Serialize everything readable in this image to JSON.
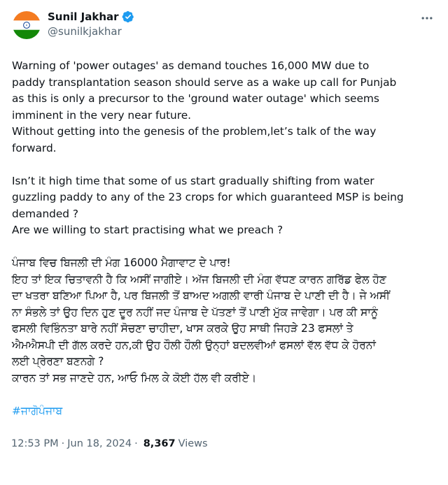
{
  "author": {
    "display_name": "Sunil Jakhar",
    "handle": "@sunilkjakhar",
    "verified": true,
    "avatar_icon": "indian-flag-avatar",
    "verified_color": "#1d9bf0"
  },
  "tweet": {
    "english": [
      "Warning of 'power outages' as demand touches 16,000 MW due to",
      "paddy transplantation season should serve as a wake up call for Punjab",
      "as this is only a precursor to the 'ground water outage' which seems",
      "imminent in the very near future.",
      "Without getting into the genesis of the problem,let’s talk of the way",
      "forward."
    ],
    "english2": [
      "Isn’t it high time that some of us start gradually shifting from water",
      "guzzling paddy to any of the 23 crops for which guaranteed MSP is being",
      "demanded ?",
      "Are we willing to start practising what we preach ?"
    ],
    "punjabi": [
      "ਪੰਜਾਬ ਵਿਚ ਬਿਜਲੀ ਦੀ ਮੰਗ 16000 ਮੈਗਾਵਾਟ ਦੇ ਪਾਰ!",
      "ਇਹ ਤਾਂ ਇਕ ਚਿਤਾਵਨੀ ਹੈ ਕਿ ਅਸੀਂ ਜਾਗੀਏ। ਅੱਜ ਬਿਜਲੀ ਦੀ ਮੰਗ ਵੱਧਣ ਕਾਰਨ ਗਰਿੱਡ ਫੇਲ ਹੋਣ",
      "ਦਾ ਖਤਰਾ ਬਣਿਆ ਪਿਆ ਹੈ, ਪਰ ਬਿਜਲੀ ਤੋਂ ਬਾਅਦ ਅਗਲੀ ਵਾਰੀ ਪੰਜਾਬ ਦੇ ਪਾਣੀ ਦੀ ਹੈ। ਜੇ ਅਸੀਂ",
      "ਨਾ ਸੰਭਲੇ ਤਾਂ ਉਹ ਦਿਨ ਹੁਣ ਦੂਰ ਨਹੀਂ ਜਦ ਪੰਜਾਬ ਦੇ ਪੱਤਣਾਂ ਤੋਂ ਪਾਣੀ ਮੁੱਕ ਜਾਵੇਗਾ। ਪਰ ਕੀ ਸਾਨੂੰ",
      "ਫਸਲੀ ਵਿਭਿੰਨਤਾ ਬਾਰੇ ਨਹੀਂ ਸੋਚਣਾ ਚਾਹੀਦਾ, ਖਾਸ ਕਰਕੇ ਉਹ ਸਾਥੀ ਜਿਹੜੇ 23 ਫਸਲਾਂ ਤੇ",
      "ਐਮਐਸਪੀ ਦੀ ਗੱਲ ਕਰਦੇ ਹਨ,ਕੀ ਉਹ ਹੌਲੀ ਹੌਲੀ ਉਨ੍ਹਾਂ ਬਦਲਵੀਆਂ ਫਸਲਾਂ ਵੱਲ ਵੱਧ ਕੇ ਹੋਰਨਾਂ",
      "ਲਈ ਪ੍ਰੇਰਣਾ ਬਣਨਗੇ ?",
      "ਕਾਰਨ ਤਾਂ ਸਭ ਜਾਣਦੇ ਹਨ, ਆਓ ਮਿਲ ਕੇ ਕੋਈ ਹੱਲ ਵੀ ਕਰੀਏ।"
    ],
    "hashtag": "#ਜਾਗੋਪੰਜਾਬ",
    "hashtag_color": "#1d9bf0"
  },
  "meta": {
    "time": "12:53 PM",
    "separator": "·",
    "date": "Jun 18, 2024",
    "views_count": "8,367",
    "views_label": "Views"
  },
  "menu": {
    "more_icon": "more-horizontal-icon"
  }
}
